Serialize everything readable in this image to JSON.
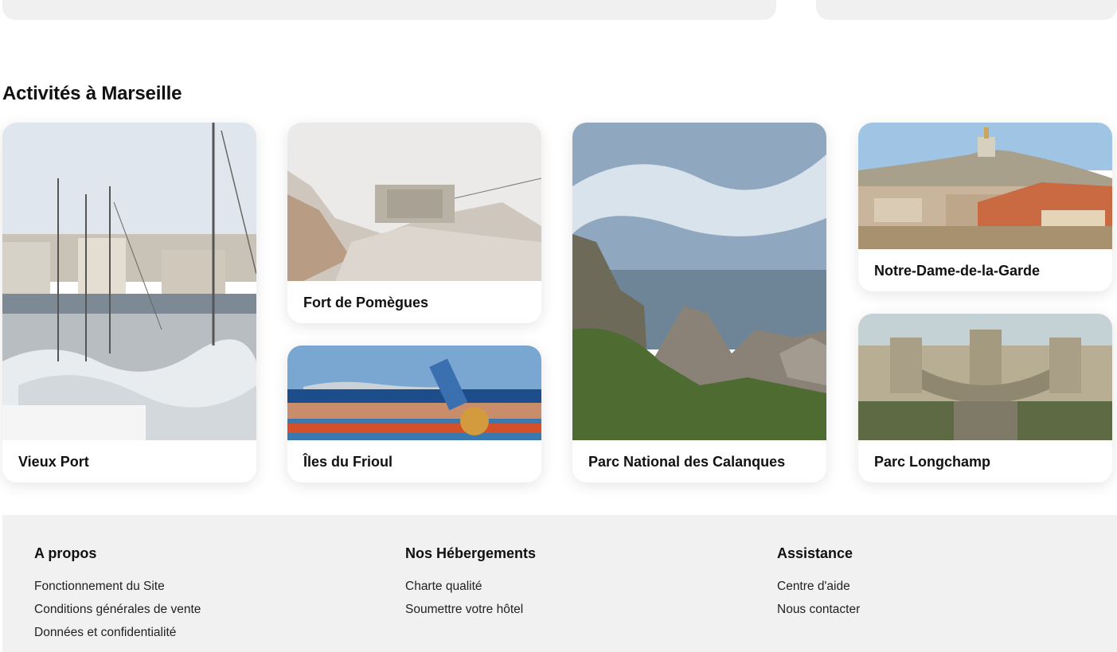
{
  "section": {
    "title": "Activités à Marseille"
  },
  "activities": [
    {
      "name": "Vieux Port"
    },
    {
      "name": "Fort de Pomègues"
    },
    {
      "name": "Îles du Frioul"
    },
    {
      "name": "Parc National des Calanques"
    },
    {
      "name": "Notre-Dame-de-la-Garde"
    },
    {
      "name": "Parc Longchamp"
    }
  ],
  "footer": {
    "columns": [
      {
        "title": "A propos",
        "links": [
          "Fonctionnement du Site",
          "Conditions générales de vente",
          "Données et confidentialité"
        ]
      },
      {
        "title": "Nos Hébergements",
        "links": [
          "Charte qualité",
          "Soumettre votre hôtel"
        ]
      },
      {
        "title": "Assistance",
        "links": [
          "Centre d'aide",
          "Nous contacter"
        ]
      }
    ]
  }
}
